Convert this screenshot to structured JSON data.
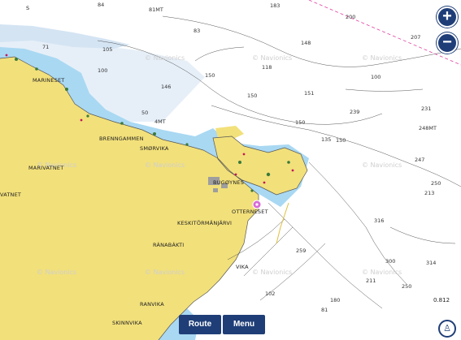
{
  "places": {
    "marineset": "MARINESET",
    "brenngammen": "BRENNGAMMEN",
    "smorvika": "SMØRVIKA",
    "marivatnet": "MARIVATNET",
    "vatnet": "VATNET",
    "bugoynes": "BUGØYNES",
    "otterneset": "OTTERNESET",
    "keskitormanjarvi": "KESKITÖRMÄNJÄRVI",
    "ranabakti": "RÁNABÁKTI",
    "ranvika": "RANVIKA",
    "skinnvika": "SKINNVIKA",
    "vika": "VIKA",
    "letter_s": "S"
  },
  "depths": {
    "d84": "84",
    "d81mt": "81MT",
    "d183": "183",
    "d200": "200",
    "d207": "207",
    "d83": "83",
    "d148": "148",
    "d71": "71",
    "d105": "105",
    "d100a": "100",
    "d118": "118",
    "d100b": "100",
    "d150a": "150",
    "d146": "146",
    "d150b": "150",
    "d151": "151",
    "d239": "239",
    "d231": "231",
    "d50": "50",
    "d4mt": "4MT",
    "d150c": "150",
    "d248mt": "248MT",
    "d135": "135",
    "d150d": "150",
    "d247": "247",
    "d250": "250",
    "d213": "213",
    "d316": "316",
    "d259": "259",
    "d300": "300",
    "d314": "314",
    "d211": "211",
    "d250b": "250",
    "d102": "102",
    "d180": "180",
    "d81": "81"
  },
  "watermark": "© Navionics",
  "controls": {
    "zoom_in": "+",
    "zoom_out": "−",
    "route": "Route",
    "menu": "Menu",
    "scale": "0.812"
  },
  "colors": {
    "land": "#f2e07a",
    "shallow": "#a9d8f2",
    "deep": "#e6eff8",
    "water": "#ffffff",
    "button": "#1f3e78"
  }
}
